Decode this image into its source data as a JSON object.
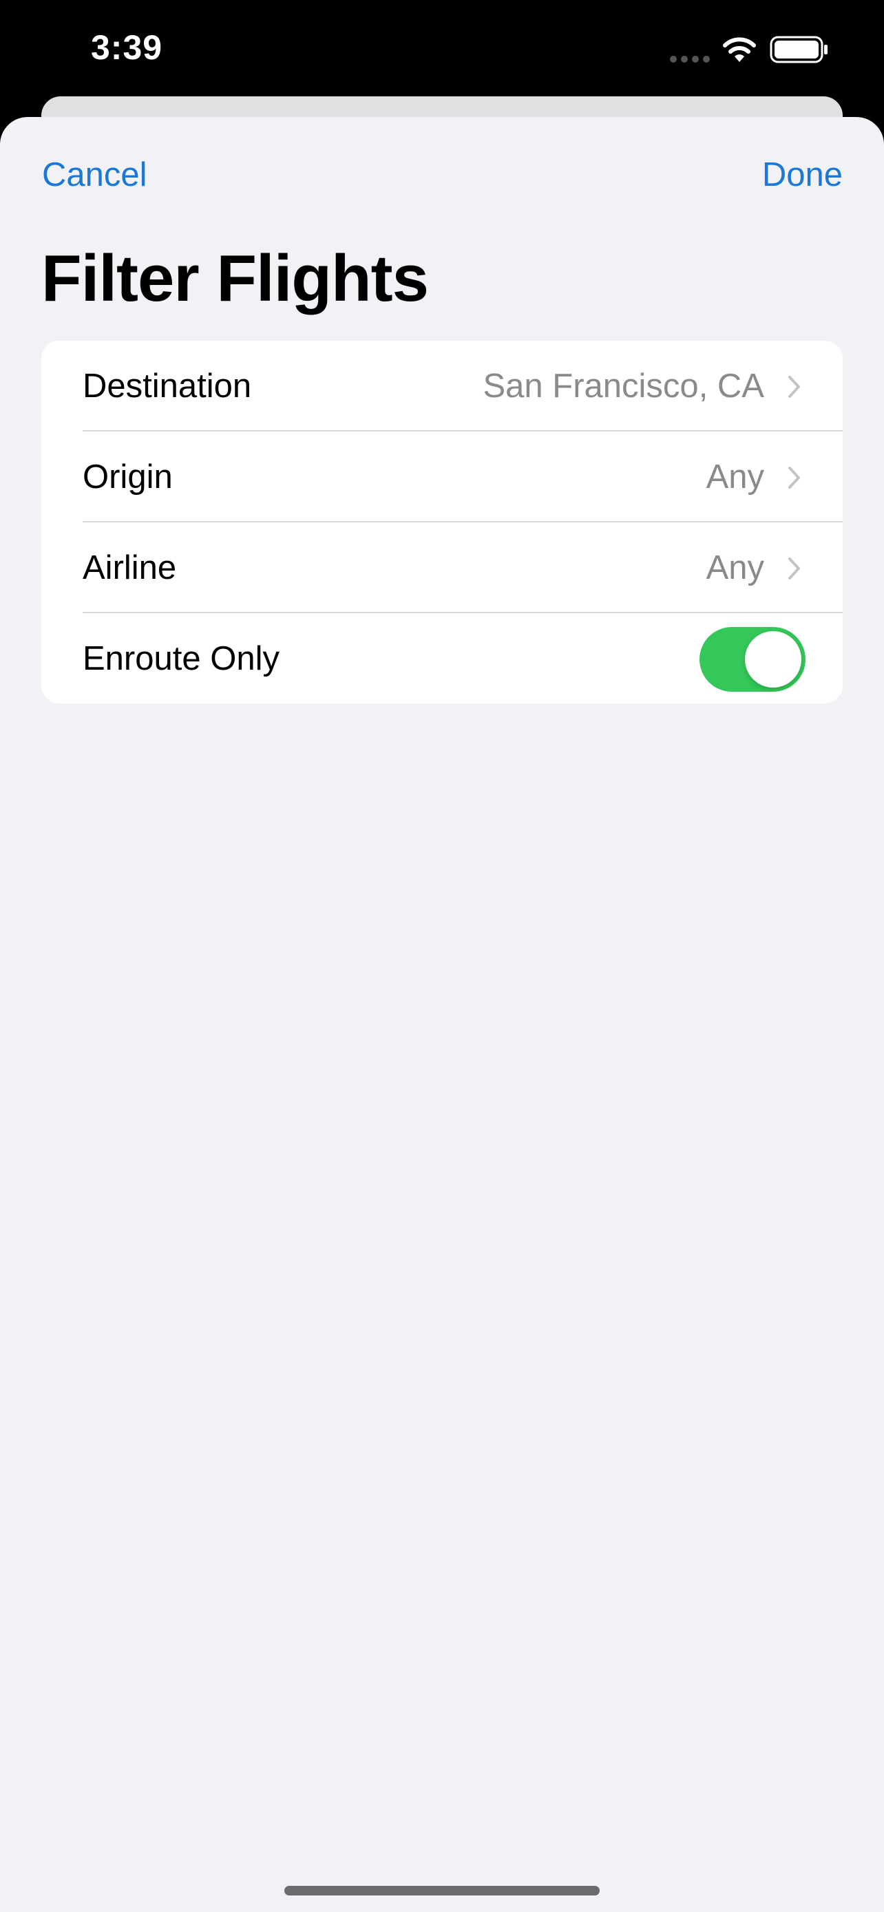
{
  "status_bar": {
    "time": "3:39",
    "signal_icon": "signal-dots-icon",
    "wifi_icon": "wifi-icon",
    "battery_icon": "battery-icon"
  },
  "nav": {
    "cancel_label": "Cancel",
    "done_label": "Done"
  },
  "title": "Filter Flights",
  "filters": [
    {
      "label": "Destination",
      "value": "San Francisco, CA",
      "icon": "chevron-right-icon"
    },
    {
      "label": "Origin",
      "value": "Any",
      "icon": "chevron-right-icon"
    },
    {
      "label": "Airline",
      "value": "Any",
      "icon": "chevron-right-icon"
    },
    {
      "label": "Enroute Only",
      "toggle_on": true
    }
  ],
  "colors": {
    "accent": "#1a78d8",
    "toggle_on": "#34c759",
    "background": "#f2f1f6",
    "secondary_text": "#8a8a8e"
  }
}
